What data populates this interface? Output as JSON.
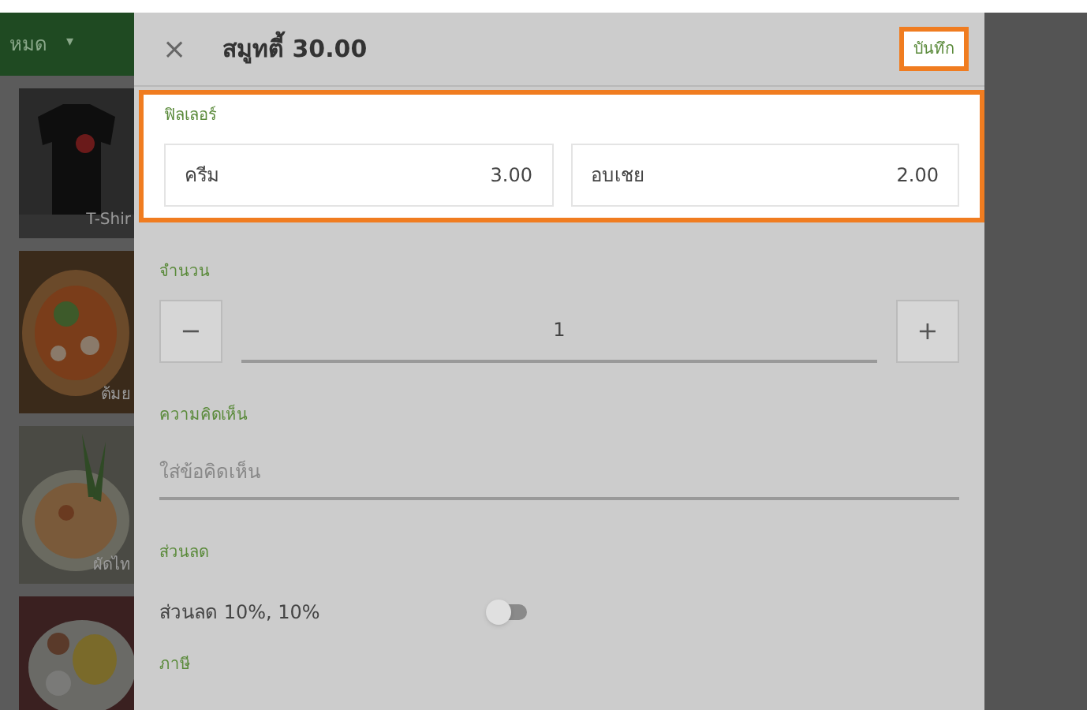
{
  "background": {
    "category_menu": {
      "label": "หมด",
      "caret": "▾"
    },
    "products": [
      {
        "kind": "shirt",
        "caption": "T-Shir"
      },
      {
        "kind": "soup",
        "caption": "ต้มย"
      },
      {
        "kind": "noodles",
        "caption": "ผัดไท"
      },
      {
        "kind": "rice"
      }
    ]
  },
  "dialog": {
    "close": "×",
    "title": "สมูทตี้ 30.00",
    "save": {
      "label": "บันทึก",
      "highlighted": true
    },
    "filler": {
      "label": "ฟิลเลอร์",
      "highlighted": true,
      "options": [
        {
          "name": "ครีม",
          "price": "3.00"
        },
        {
          "name": "อบเชย",
          "price": "2.00"
        }
      ]
    },
    "quantity": {
      "label": "จำนวน",
      "minus": "−",
      "value": "1",
      "plus": "+"
    },
    "comment": {
      "label": "ความคิดเห็น",
      "placeholder": "ใส่ข้อคิดเห็น"
    },
    "discount": {
      "label": "ส่วนลด",
      "items": [
        {
          "name": "ส่วนลด 10%, 10%",
          "on": false
        }
      ]
    },
    "tax": {
      "label": "ภาษี"
    }
  }
}
